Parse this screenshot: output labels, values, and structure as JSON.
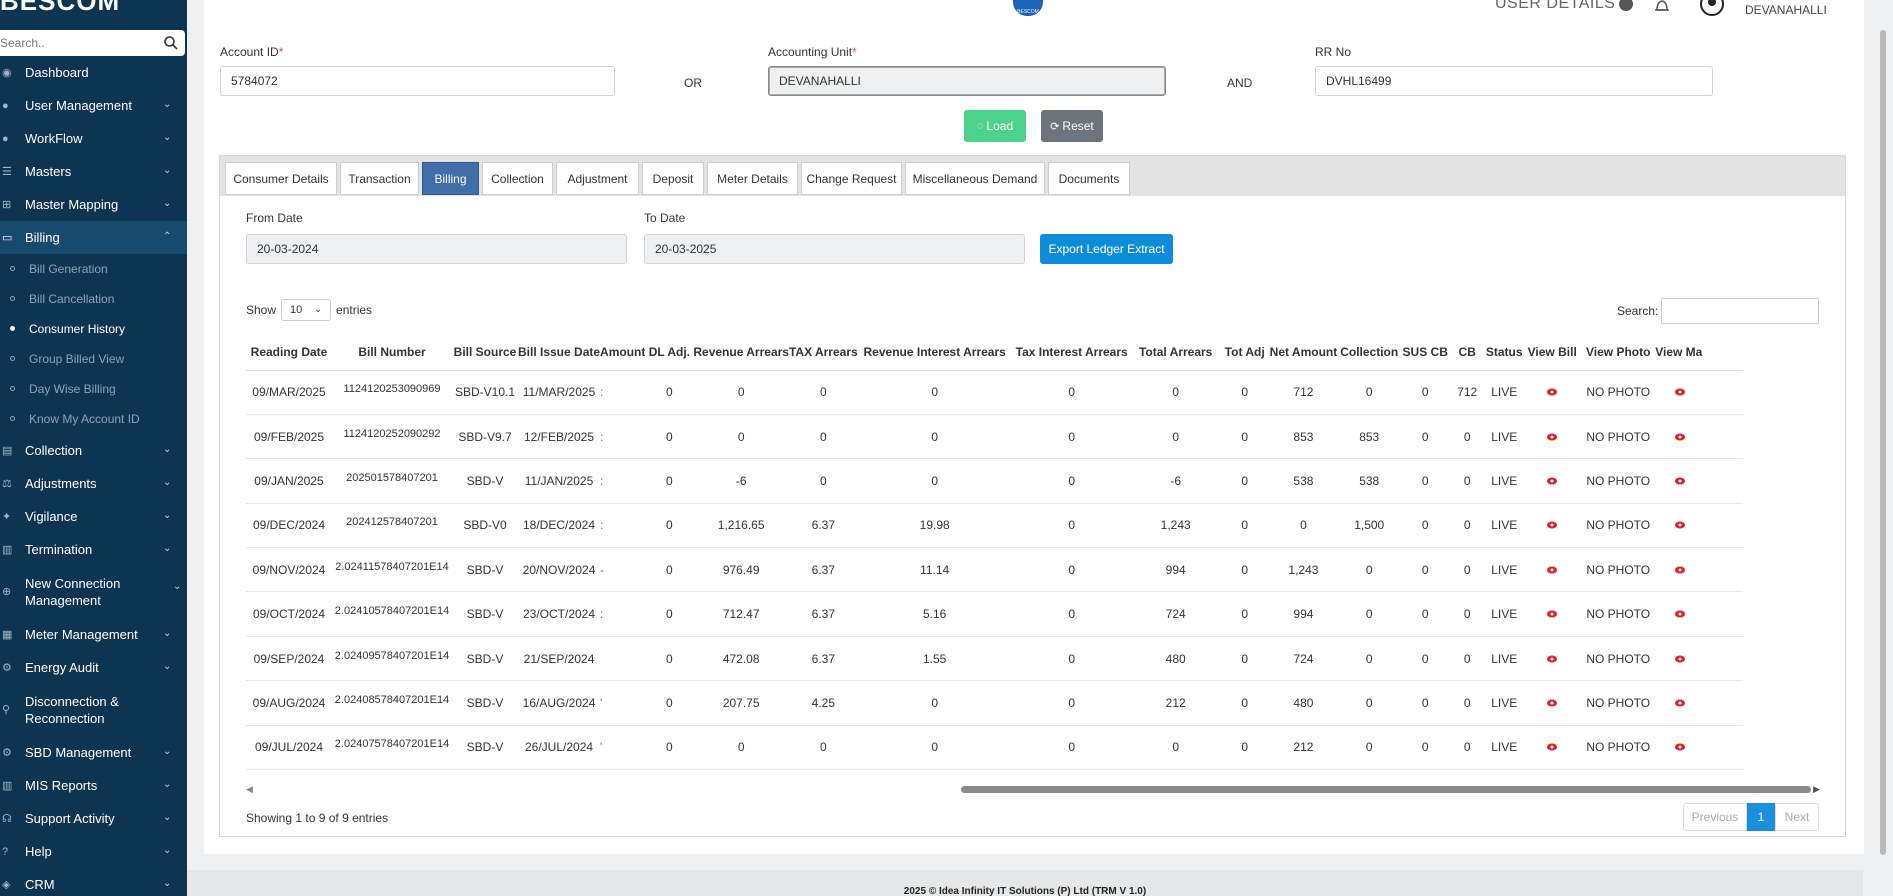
{
  "brand": "BESCOM",
  "sidebar": {
    "search_placeholder": "Search..",
    "items": [
      {
        "label": "Dashboard",
        "icon": "dashboard-icon",
        "chevron": false
      },
      {
        "label": "User Management",
        "icon": "user-icon",
        "chevron": true
      },
      {
        "label": "WorkFlow",
        "icon": "user-icon",
        "chevron": true
      },
      {
        "label": "Masters",
        "icon": "list-icon",
        "chevron": true
      },
      {
        "label": "Master Mapping",
        "icon": "sitemap-icon",
        "chevron": true
      },
      {
        "label": "Billing",
        "icon": "monitor-icon",
        "chevron": true,
        "active": true
      }
    ],
    "billing_sub": [
      {
        "label": "Bill Generation"
      },
      {
        "label": "Bill Cancellation"
      },
      {
        "label": "Consumer History",
        "current": true
      },
      {
        "label": "Group Billed View"
      },
      {
        "label": "Day Wise Billing"
      },
      {
        "label": "Know My Account ID"
      }
    ],
    "items2": [
      {
        "label": "Collection",
        "icon": "collection-icon"
      },
      {
        "label": "Adjustments",
        "icon": "adjust-icon"
      },
      {
        "label": "Vigilance",
        "icon": "vigilance-icon"
      },
      {
        "label": "Termination",
        "icon": "trash-icon"
      }
    ],
    "new_connection": "New Connection Management",
    "items3": [
      {
        "label": "Meter Management",
        "icon": "meter-icon"
      },
      {
        "label": "Energy Audit",
        "icon": "cogs-icon"
      }
    ],
    "disconnection": "Disconnection & Reconnection",
    "items4": [
      {
        "label": "SBD Management",
        "icon": "gear-icon"
      },
      {
        "label": "MIS Reports",
        "icon": "chart-icon"
      },
      {
        "label": "Support Activity",
        "icon": "headset-icon"
      },
      {
        "label": "Help",
        "icon": "help-icon"
      },
      {
        "label": "CRM",
        "icon": "crm-icon"
      }
    ]
  },
  "topbar": {
    "logo_text": "BESCOM",
    "user_details": "USER DETAILS",
    "user_name": "DEVANAHALLI"
  },
  "form": {
    "account_id_label": "Account ID",
    "account_id_value": "5784072",
    "or_label": "OR",
    "accounting_unit_label": "Accounting Unit",
    "accounting_unit_value": "DEVANAHALLI",
    "and_label": "AND",
    "rr_no_label": "RR No",
    "rr_no_value": "DVHL16499",
    "load_label": "Load",
    "reset_label": "Reset"
  },
  "tabs": [
    {
      "label": "Consumer Details"
    },
    {
      "label": "Transaction"
    },
    {
      "label": "Billing",
      "active": true
    },
    {
      "label": "Collection"
    },
    {
      "label": "Adjustment"
    },
    {
      "label": "Deposit"
    },
    {
      "label": "Meter Details"
    },
    {
      "label": "Change Request"
    },
    {
      "label": "Miscellaneous Demand"
    },
    {
      "label": "Documents"
    }
  ],
  "billing": {
    "from_date_label": "From Date",
    "from_date_value": "20-03-2024",
    "to_date_label": "To Date",
    "to_date_value": "20-03-2025",
    "export_label": "Export Ledger Extract",
    "show_label": "Show",
    "entries_value": "10",
    "entries_label": "entries",
    "search_label": "Search:",
    "info": "Showing 1 to 9 of 9 entries",
    "prev_label": "Previous",
    "page": "1",
    "next_label": "Next"
  },
  "table": {
    "headers": [
      "Reading Date",
      "Bill Number",
      "Bill Source",
      "Bill Issue Date",
      "Amount",
      "DL Adj.",
      "Revenue Arrears",
      "TAX Arrears",
      "Revenue Interest Arrears",
      "Tax Interest Arrears",
      "Total Arrears",
      "Tot Adj",
      "Net Amount",
      "Collection",
      "SUS CB",
      "CB",
      "Status",
      "View Bill",
      "View Photo",
      "View Ma"
    ],
    "rows": [
      [
        "09/MAR/2025",
        "1124120253090969",
        "SBD-V10.1",
        "11/MAR/2025",
        ":",
        "0",
        "0",
        "0",
        "0",
        "0",
        "0",
        "0",
        "712",
        "0",
        "0",
        "712",
        "LIVE",
        "",
        "NO PHOTO",
        ""
      ],
      [
        "09/FEB/2025",
        "1124120252090292",
        "SBD-V9.7",
        "12/FEB/2025",
        ":",
        "0",
        "0",
        "0",
        "0",
        "0",
        "0",
        "0",
        "853",
        "853",
        "0",
        "0",
        "LIVE",
        "",
        "NO PHOTO",
        ""
      ],
      [
        "09/JAN/2025",
        "202501578407201",
        "SBD-V",
        "11/JAN/2025",
        ":",
        "0",
        "-6",
        "0",
        "0",
        "0",
        "-6",
        "0",
        "538",
        "538",
        "0",
        "0",
        "LIVE",
        "",
        "NO PHOTO",
        ""
      ],
      [
        "09/DEC/2024",
        "202412578407201",
        "SBD-V0",
        "18/DEC/2024",
        ":",
        "0",
        "1,216.65",
        "6.37",
        "19.98",
        "0",
        "1,243",
        "0",
        "0",
        "1,500",
        "0",
        "0",
        "LIVE",
        "",
        "NO PHOTO",
        ""
      ],
      [
        "09/NOV/2024",
        "2.02411578407201E14",
        "SBD-V",
        "20/NOV/2024",
        "-",
        "0",
        "976.49",
        "6.37",
        "11.14",
        "0",
        "994",
        "0",
        "1,243",
        "0",
        "0",
        "0",
        "LIVE",
        "",
        "NO PHOTO",
        ""
      ],
      [
        "09/OCT/2024",
        "2.02410578407201E14",
        "SBD-V",
        "23/OCT/2024",
        ":",
        "0",
        "712.47",
        "6.37",
        "5.16",
        "0",
        "724",
        "0",
        "994",
        "0",
        "0",
        "0",
        "LIVE",
        "",
        "NO PHOTO",
        ""
      ],
      [
        "09/SEP/2024",
        "2.02409578407201E14",
        "SBD-V",
        "21/SEP/2024",
        "",
        "0",
        "472.08",
        "6.37",
        "1.55",
        "0",
        "480",
        "0",
        "724",
        "0",
        "0",
        "0",
        "LIVE",
        "",
        "NO PHOTO",
        ""
      ],
      [
        "09/AUG/2024",
        "2.02408578407201E14",
        "SBD-V",
        "16/AUG/2024",
        "'",
        "0",
        "207.75",
        "4.25",
        "0",
        "0",
        "212",
        "0",
        "480",
        "0",
        "0",
        "0",
        "LIVE",
        "",
        "NO PHOTO",
        ""
      ],
      [
        "09/JUL/2024",
        "2.02407578407201E14",
        "SBD-V",
        "26/JUL/2024",
        "'",
        "0",
        "0",
        "0",
        "0",
        "0",
        "0",
        "0",
        "212",
        "0",
        "0",
        "0",
        "LIVE",
        "",
        "NO PHOTO",
        ""
      ]
    ]
  },
  "footer": "2025 © Idea Infinity IT Solutions (P) Ltd (TRM V 1.0)",
  "colors": {
    "sidebar_bg": "#0d3552",
    "active_tab": "#3f6fa6",
    "load_button": "#4cd28b",
    "export_button": "#0d8cdc",
    "eye_icon": "#e02020"
  }
}
